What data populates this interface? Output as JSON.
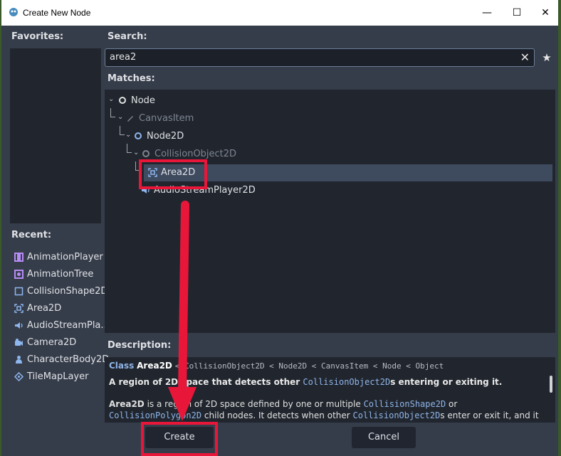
{
  "window": {
    "title": "Create New Node",
    "minimize": "—",
    "maximize": "☐",
    "close": "✕"
  },
  "favorites": {
    "label": "Favorites:"
  },
  "recent": {
    "label": "Recent:",
    "items": [
      {
        "label": "AnimationPlayer",
        "icon": "animation-player-icon",
        "color": "#b68bf5"
      },
      {
        "label": "AnimationTree",
        "icon": "animation-tree-icon",
        "color": "#b68bf5"
      },
      {
        "label": "CollisionShape2D",
        "icon": "collision-shape-icon",
        "color": "#8eb6ef"
      },
      {
        "label": "Area2D",
        "icon": "area2d-icon",
        "color": "#8eb6ef"
      },
      {
        "label": "AudioStreamPla...",
        "icon": "audio-stream-icon",
        "color": "#8eb6ef"
      },
      {
        "label": "Camera2D",
        "icon": "camera-icon",
        "color": "#8eb6ef"
      },
      {
        "label": "CharacterBody2D",
        "icon": "character-body-icon",
        "color": "#8eb6ef"
      },
      {
        "label": "TileMapLayer",
        "icon": "tilemap-icon",
        "color": "#8eb6ef"
      }
    ]
  },
  "search": {
    "label": "Search:",
    "value": "area2",
    "clear": "✕",
    "favorite": "★"
  },
  "matches": {
    "label": "Matches:",
    "tree": [
      {
        "label": "Node",
        "chev": "⌄"
      },
      {
        "label": "CanvasItem",
        "chev": "⌄"
      },
      {
        "label": "Node2D",
        "chev": "⌄"
      },
      {
        "label": "CollisionObject2D",
        "chev": "⌄"
      },
      {
        "label": "Area2D"
      },
      {
        "label": "AudioStreamPlayer2D"
      }
    ]
  },
  "description": {
    "label": "Description:",
    "class_kw": "Class",
    "class_name": "Area2D",
    "inheritance": "< CollisionObject2D < Node2D < CanvasItem < Node < Object",
    "summary_a": "A region of 2D space that detects other ",
    "summary_link": "CollisionObject2D",
    "summary_b": "s entering or exiting it.",
    "body_bold": "Area2D",
    "body_a": " is a region of 2D space defined by one or multiple ",
    "body_link1": "CollisionShape2D",
    "body_b": " or",
    "body_link2": "CollisionPolygon2D",
    "body_c": " child nodes. It detects when other ",
    "body_link3": "CollisionObject2D",
    "body_d": "s enter or exit it, and it"
  },
  "buttons": {
    "create": "Create",
    "cancel": "Cancel"
  },
  "colors": {
    "highlight": "#e8173a",
    "accent": "#8eb6ef"
  }
}
